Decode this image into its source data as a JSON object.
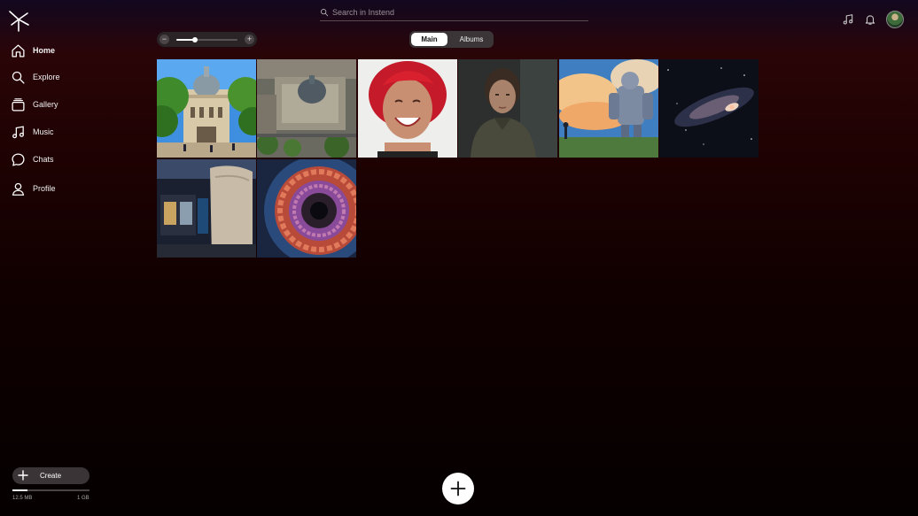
{
  "app": {
    "logo_icon": "instend-logo-icon"
  },
  "sidebar": {
    "items": [
      {
        "label": "Home",
        "icon": "home-icon",
        "active": true
      },
      {
        "label": "Explore",
        "icon": "search-icon"
      },
      {
        "label": "Gallery",
        "icon": "gallery-icon"
      },
      {
        "label": "Music",
        "icon": "music-note-icon"
      },
      {
        "label": "Chats",
        "icon": "chat-bubble-icon"
      },
      {
        "label": "Profile",
        "icon": "user-icon"
      }
    ],
    "create_label": "Create",
    "storage": {
      "used": "12.5 MB",
      "total": "1 GB",
      "used_fraction": 0.2
    }
  },
  "header": {
    "search_placeholder": "Search in Instend",
    "icons": [
      "music-note-icon",
      "bell-icon",
      "avatar"
    ]
  },
  "toolbar": {
    "zoom_level": 0.3,
    "tabs": [
      {
        "label": "Main",
        "selected": true
      },
      {
        "label": "Albums",
        "selected": false
      }
    ]
  },
  "gallery": {
    "photos": [
      {
        "subject": "domed university building behind trees"
      },
      {
        "subject": "aerial view of domed campus building"
      },
      {
        "subject": "smiling woman with red hair"
      },
      {
        "subject": "video game character portrait"
      },
      {
        "subject": "illustrated giant robot in clouds"
      },
      {
        "subject": "spiral galaxy"
      },
      {
        "subject": "museum exhibition hall"
      },
      {
        "subject": "particle detector cross-section"
      }
    ]
  },
  "colors": {
    "accent": "#ffffff",
    "background_top": "#2a0508",
    "background_bottom": "#050000"
  }
}
